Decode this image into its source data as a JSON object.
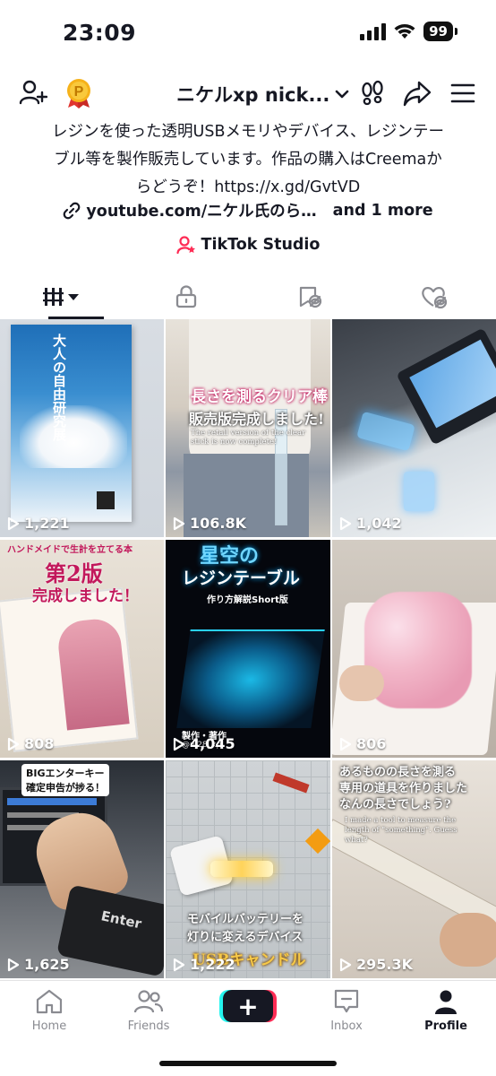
{
  "status_bar": {
    "time": "23:09",
    "battery": "99"
  },
  "header": {
    "username": "ニケルxp nick..."
  },
  "bio": {
    "lines": [
      "レジンを使った透明USBメモリやデバイス、レジンテー",
      "ブル等を製作販売しています。作品の購入はCreemaか",
      "らどうぞ！https://x.gd/GvtVD"
    ],
    "link_text": "youtube.com/ニケル氏のら…",
    "link_more": "and 1 more",
    "studio_label": "TikTok Studio"
  },
  "videos": [
    {
      "views": "1,221",
      "caption": "大人の自由研究展"
    },
    {
      "views": "106.8K",
      "caption": "長さを測るクリア棒",
      "caption2": "販売版完成しました!",
      "caption3": "The retail version of the clear stick is now complete!"
    },
    {
      "views": "1,042"
    },
    {
      "views": "808",
      "caption": "ハンドメイドで生計を立てる本",
      "caption2": "第2版",
      "caption3": "完成しました！"
    },
    {
      "views": "4,045",
      "caption": "星空の",
      "caption2": "レジンテーブル",
      "caption3": "作り方解説Short版",
      "caption4": "製作・著作",
      "caption5": "@ni28_xp"
    },
    {
      "views": "806"
    },
    {
      "views": "1,625",
      "caption": "BIGエンターキー",
      "caption2": "確定申告が捗る！",
      "caption3": "Enter"
    },
    {
      "views": "1,222",
      "caption": "モバイルバッテリーを",
      "caption2": "灯りに変えるデバイス",
      "caption3": "USBキャンドル"
    },
    {
      "views": "295.3K",
      "caption": "あるものの長さを測る",
      "caption2": "専用の道具を作りました",
      "caption3": "なんの長さでしょう?",
      "caption4": "I made a tool to measure the length of \"something\". Guess what?"
    }
  ],
  "nav": {
    "home": "Home",
    "friends": "Friends",
    "inbox": "Inbox",
    "profile": "Profile"
  },
  "colors": {
    "accent_red": "#fe2c55",
    "accent_cyan": "#25f4ee",
    "text": "#161823"
  }
}
